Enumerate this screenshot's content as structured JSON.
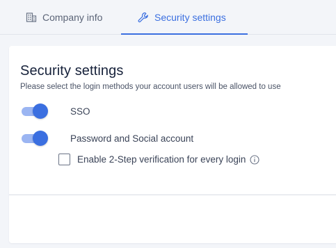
{
  "tabs": [
    {
      "label": "Company info",
      "icon": "building-icon",
      "active": false
    },
    {
      "label": "Security settings",
      "icon": "wrench-icon",
      "active": true
    }
  ],
  "colors": {
    "accent": "#3b6fe0",
    "accent_light": "#9bb5f2"
  },
  "security": {
    "title": "Security settings",
    "subtitle": "Please select the login methods your account users will be allowed to use",
    "options": [
      {
        "label": "SSO",
        "enabled": true
      },
      {
        "label": "Password and Social account",
        "enabled": true
      }
    ],
    "two_step": {
      "label": "Enable 2-Step verification for every login",
      "checked": false
    }
  }
}
